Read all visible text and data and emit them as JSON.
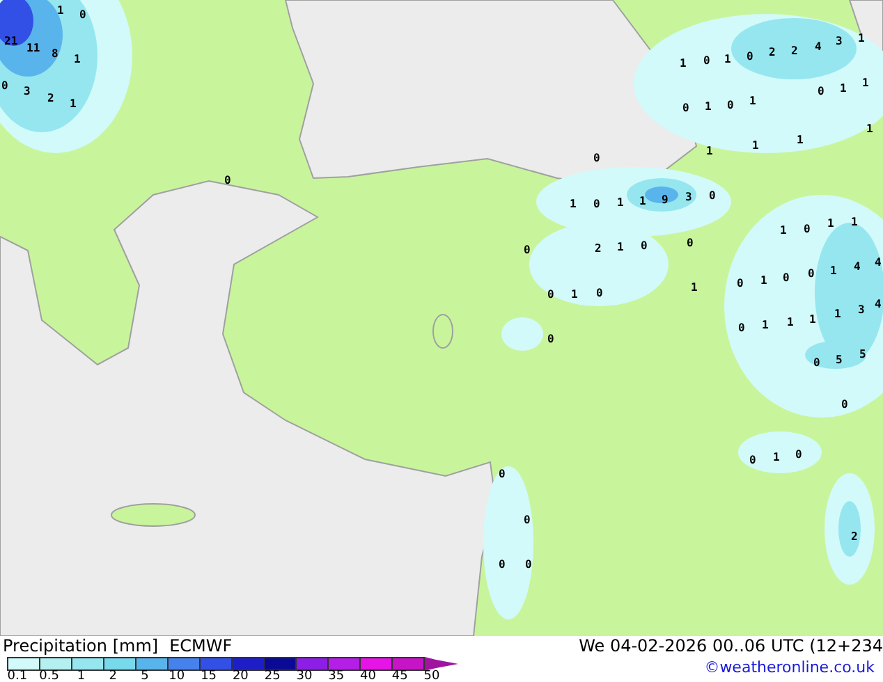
{
  "map": {
    "labels": [
      "1",
      "0",
      "21",
      "11",
      "8",
      "1",
      "0",
      "3",
      "2",
      "1",
      "1",
      "0",
      "1",
      "0",
      "2",
      "2",
      "4",
      "3",
      "1",
      "0",
      "1",
      "0",
      "1",
      "0",
      "1",
      "1",
      "1",
      "1",
      "1",
      "1",
      "0",
      "0",
      "1",
      "0",
      "1",
      "1",
      "9",
      "3",
      "0",
      "0",
      "2",
      "1",
      "0",
      "0",
      "1",
      "0",
      "1",
      "1",
      "1",
      "0",
      "1",
      "0",
      "0",
      "0",
      "1",
      "0",
      "0",
      "1",
      "4",
      "4",
      "0",
      "1",
      "1",
      "1",
      "1",
      "3",
      "4",
      "0",
      "5",
      "5",
      "0",
      "0",
      "0",
      "1",
      "0",
      "0",
      "0",
      "0",
      "2"
    ]
  },
  "legend": {
    "title": "Precipitation [mm]",
    "model": "ECMWF",
    "valid": "We 04-02-2026 00..06 UTC (12+234",
    "credit": "©weatheronline.co.uk",
    "ticks": [
      "0.1",
      "0.5",
      "1",
      "2",
      "5",
      "10",
      "15",
      "20",
      "25",
      "30",
      "35",
      "40",
      "45",
      "50"
    ],
    "swatches": [
      {
        "color": "#d2fafa"
      },
      {
        "color": "#b4f0f0"
      },
      {
        "color": "#96e6f0"
      },
      {
        "color": "#78d8ec"
      },
      {
        "color": "#5ab4ec"
      },
      {
        "color": "#4682ec"
      },
      {
        "color": "#3250e6"
      },
      {
        "color": "#1e1ec8"
      },
      {
        "color": "#0a0a96"
      },
      {
        "color": "#8c1ee6"
      },
      {
        "color": "#b41ee6"
      },
      {
        "color": "#e614e6"
      },
      {
        "color": "#c814c8"
      }
    ],
    "arrow": {
      "color": "#a014a0"
    }
  }
}
